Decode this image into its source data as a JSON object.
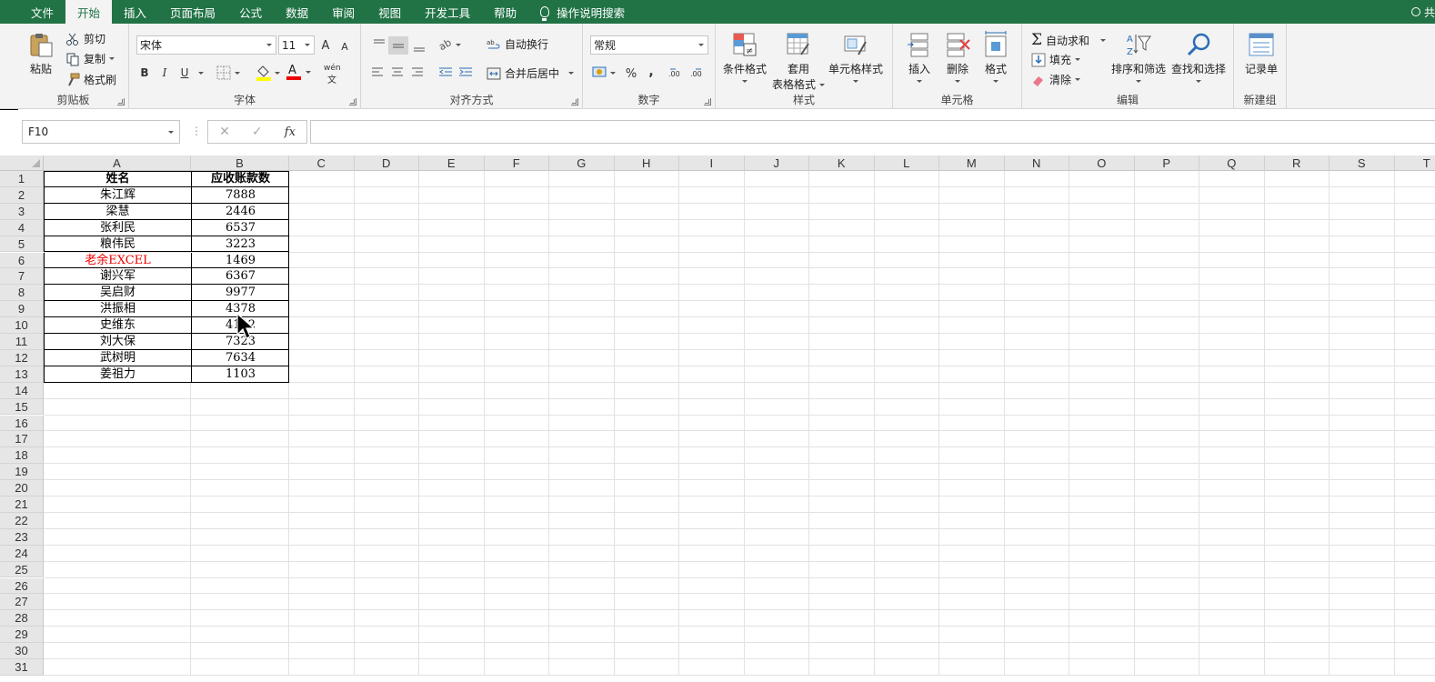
{
  "tabs": [
    {
      "label": "文件",
      "active": false
    },
    {
      "label": "开始",
      "active": true
    },
    {
      "label": "插入",
      "active": false
    },
    {
      "label": "页面布局",
      "active": false
    },
    {
      "label": "公式",
      "active": false
    },
    {
      "label": "数据",
      "active": false
    },
    {
      "label": "审阅",
      "active": false
    },
    {
      "label": "视图",
      "active": false
    },
    {
      "label": "开发工具",
      "active": false
    },
    {
      "label": "帮助",
      "active": false
    }
  ],
  "tell_me": "操作说明搜索",
  "share_label": "共",
  "ribbon": {
    "clipboard": {
      "label": "剪贴板",
      "paste": "粘贴",
      "cut": "剪切",
      "copy": "复制",
      "format_painter": "格式刷"
    },
    "font": {
      "label": "字体",
      "font_name": "宋体",
      "font_size": "11",
      "bold": "B",
      "italic": "I",
      "underline": "U",
      "grow": "A",
      "shrink": "A",
      "font_color": "A",
      "phonetic": "wén"
    },
    "alignment": {
      "label": "对齐方式",
      "wrap": "自动换行",
      "merge": "合并后居中"
    },
    "number": {
      "label": "数字",
      "format": "常规",
      "percent": "%",
      "comma": ","
    },
    "styles": {
      "label": "样式",
      "conditional": "条件格式",
      "table_format_1": "套用",
      "table_format_2": "表格格式",
      "cell_styles": "单元格样式"
    },
    "cells": {
      "label": "单元格",
      "insert": "插入",
      "delete": "删除",
      "format": "格式"
    },
    "editing": {
      "label": "编辑",
      "autosum": "自动求和",
      "fill": "填充",
      "clear": "清除",
      "sort_filter": "排序和筛选",
      "find_select": "查找和选择"
    },
    "new_group": {
      "label": "新建组",
      "form": "记录单"
    }
  },
  "formula_bar": {
    "name_box": "F10",
    "cancel": "✕",
    "enter": "✓",
    "fx": "fx",
    "formula": ""
  },
  "columns": [
    "A",
    "B",
    "C",
    "D",
    "E",
    "F",
    "G",
    "H",
    "I",
    "J",
    "K",
    "L",
    "M",
    "N",
    "O",
    "P",
    "Q",
    "R",
    "S",
    "T"
  ],
  "rows": [
    "1",
    "2",
    "3",
    "4",
    "5",
    "6",
    "7",
    "8",
    "9",
    "10",
    "11",
    "12",
    "13",
    "14",
    "15",
    "16",
    "17",
    "18",
    "19",
    "20",
    "21",
    "22",
    "23",
    "24",
    "25",
    "26",
    "27",
    "28",
    "29",
    "30",
    "31"
  ],
  "table": {
    "headers": [
      "姓名",
      "应收账款数"
    ],
    "data": [
      [
        "朱江辉",
        "7888"
      ],
      [
        "梁慧",
        "2446"
      ],
      [
        "张利民",
        "6537"
      ],
      [
        "粮伟民",
        "3223"
      ],
      [
        "老余EXCEL",
        "1469"
      ],
      [
        "谢兴军",
        "6367"
      ],
      [
        "吴启财",
        "9977"
      ],
      [
        "洪振相",
        "4378"
      ],
      [
        "史维东",
        "4112"
      ],
      [
        "刘大保",
        "7323"
      ],
      [
        "武树明",
        "7634"
      ],
      [
        "姜祖力",
        "1103"
      ]
    ],
    "red_row_index": 4
  },
  "colors": {
    "accent": "#217346",
    "ribbon_bg": "#f3f3f3",
    "red_text": "#e00000"
  }
}
